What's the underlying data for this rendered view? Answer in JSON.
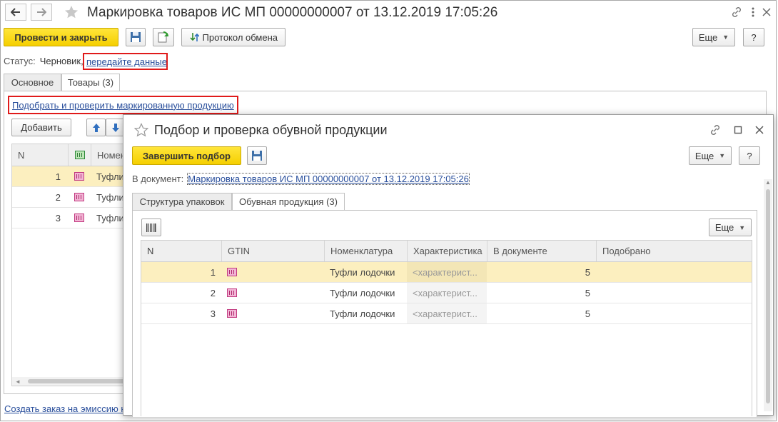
{
  "main_window": {
    "title": "Маркировка товаров ИС МП 00000000007 от 13.12.2019 17:05:26",
    "toolbar": {
      "post_close_label": "Провести и закрыть",
      "exchange_log_label": "Протокол обмена",
      "more_label": "Еще",
      "help_label": "?"
    },
    "status": {
      "label": "Статус:",
      "value": "Черновик,",
      "link": "передайте данные"
    },
    "tabs": [
      {
        "label": "Основное",
        "active": false
      },
      {
        "label": "Товары (3)",
        "active": true
      }
    ],
    "select_check_link": "Подобрать и проверить маркированную продукцию",
    "add_button_label": "Добавить",
    "table": {
      "columns": [
        "N",
        "",
        "Номен"
      ],
      "rows": [
        {
          "n": "1",
          "name": "Туфли"
        },
        {
          "n": "2",
          "name": "Туфли"
        },
        {
          "n": "3",
          "name": "Туфли"
        }
      ]
    },
    "footer_link": "Создать заказ на эмиссию к"
  },
  "dialog": {
    "title": "Подбор и проверка обувной продукции",
    "finish_label": "Завершить подбор",
    "more_label": "Еще",
    "help_label": "?",
    "doc_label": "В документ:",
    "doc_link": "Маркировка товаров ИС МП 00000000007 от 13.12.2019 17:05:26",
    "tabs": [
      {
        "label": "Структура упаковок",
        "active": false
      },
      {
        "label": "Обувная продукция (3)",
        "active": true
      }
    ],
    "grid_more_label": "Еще",
    "table": {
      "columns": [
        "N",
        "GTIN",
        "Номенклатура",
        "Характеристика",
        "В документе",
        "Подобрано"
      ],
      "rows": [
        {
          "n": "1",
          "name": "Туфли лодочки",
          "characteristic": "<характерист...",
          "in_doc": "5",
          "picked": ""
        },
        {
          "n": "2",
          "name": "Туфли лодочки",
          "characteristic": "<характерист...",
          "in_doc": "5",
          "picked": ""
        },
        {
          "n": "3",
          "name": "Туфли лодочки",
          "characteristic": "<характерист...",
          "in_doc": "5",
          "picked": ""
        }
      ]
    }
  },
  "colors": {
    "primary_button": "#f5cf00",
    "link": "#2a4f9c",
    "highlight_border": "#e01a1a",
    "selected_row": "#fcefbf"
  },
  "icons": [
    "back-arrow-icon",
    "forward-arrow-icon",
    "star-icon",
    "link-icon",
    "more-vert-icon",
    "close-icon",
    "save-icon",
    "refresh-icon",
    "exchange-log-icon",
    "arrow-up-icon",
    "arrow-down-icon",
    "mark-code-icon",
    "maximize-icon",
    "barcode-scan-icon"
  ]
}
